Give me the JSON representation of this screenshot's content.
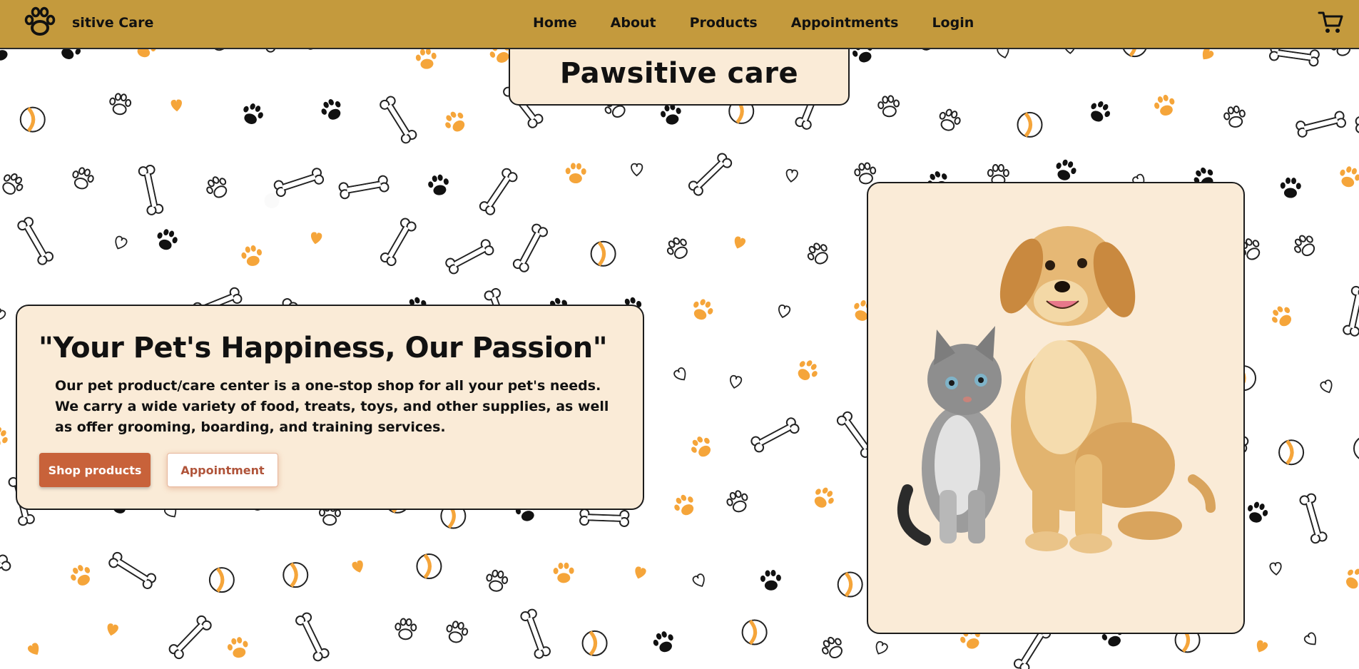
{
  "nav": {
    "brand": "sitive Care",
    "links": [
      "Home",
      "About",
      "Products",
      "Appointments",
      "Login"
    ],
    "logo_icon": "paw-icon",
    "cart_icon": "cart-icon"
  },
  "title": "Pawsitive care",
  "hero": {
    "heading": "\"Your Pet's Happiness, Our Passion\"",
    "description": "Our pet product/care center is a one-stop shop for all your pet's needs. We carry a wide variety of food, treats, toys, and other supplies, as well as offer grooming, boarding, and training services.",
    "primary_button": "Shop products",
    "secondary_button": "Appointment"
  },
  "colors": {
    "navbar": "#c49a3d",
    "card": "#faebd7",
    "primary_button": "#c8623a",
    "accent_orange": "#f5a53a"
  }
}
